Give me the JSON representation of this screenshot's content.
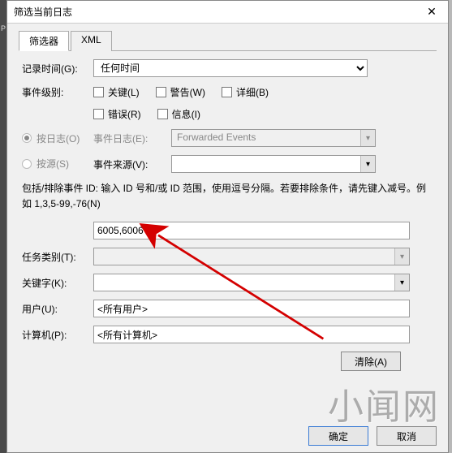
{
  "window": {
    "title": "筛选当前日志"
  },
  "tabs": {
    "filter": "筛选器",
    "xml": "XML"
  },
  "labels": {
    "logged": "记录时间(G):",
    "level": "事件级别:",
    "by_log": "按日志(O)",
    "by_source": "按源(S)",
    "event_log": "事件日志(E):",
    "event_source": "事件来源(V):",
    "task": "任务类别(T):",
    "keywords": "关键字(K):",
    "user": "用户(U):",
    "computer": "计算机(P):"
  },
  "logged_options": {
    "selected": "任何时间"
  },
  "levels": {
    "critical": "关键(L)",
    "warning": "警告(W)",
    "verbose": "详细(B)",
    "error": "错误(R)",
    "info": "信息(I)"
  },
  "event_log_value": "Forwarded Events",
  "event_source_value": "",
  "help_text": "包括/排除事件 ID: 输入 ID 号和/或 ID 范围，使用逗号分隔。若要排除条件，请先键入减号。例如 1,3,5-99,-76(N)",
  "id_input": "6005,6006",
  "task_value": "",
  "keywords_value": "",
  "user_value": "<所有用户>",
  "computer_value": "<所有计算机>",
  "buttons": {
    "clear": "清除(A)",
    "ok": "确定",
    "cancel": "取消"
  },
  "watermark": "小闻网"
}
